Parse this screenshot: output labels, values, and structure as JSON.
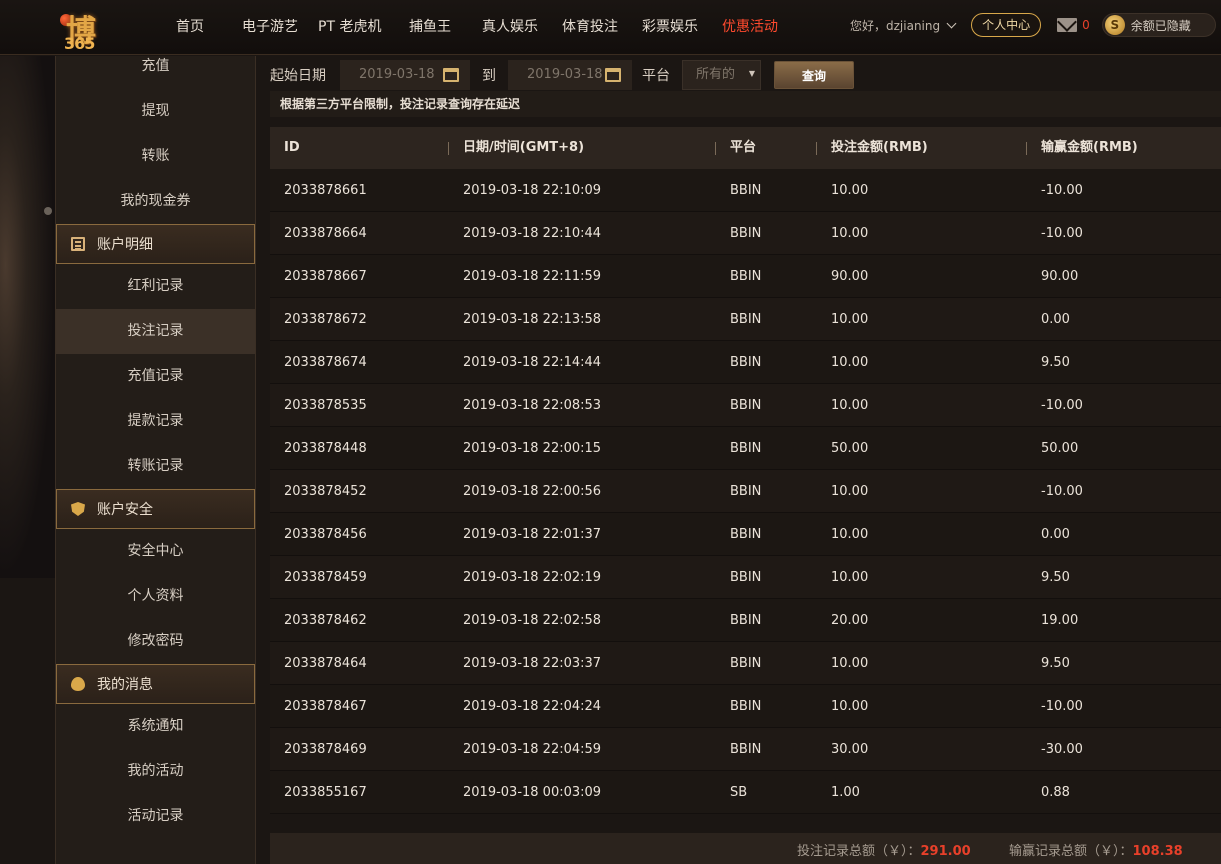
{
  "logo": {
    "text": "博",
    "num": "365"
  },
  "nav": {
    "items": [
      {
        "label": "首页",
        "left": 0
      },
      {
        "label": "电子游艺",
        "left": 0
      },
      {
        "label": "PT 老虎机",
        "left": 0
      },
      {
        "label": "捕鱼王",
        "left": 0
      },
      {
        "label": "真人娱乐",
        "left": 0
      },
      {
        "label": "体育投注",
        "left": 0
      },
      {
        "label": "彩票娱乐",
        "left": 0
      },
      {
        "label": "优惠活动",
        "left": 0
      }
    ]
  },
  "user": {
    "greeting": "您好，dzjianing",
    "center_label": "个人中心",
    "mail_count": "0",
    "balance_label": "余额已隐藏",
    "coin_symbol": "S"
  },
  "sidebar": {
    "top_links": [
      "充值",
      "提现",
      "转账",
      "我的现金券"
    ],
    "account_detail": {
      "title": "账户明细",
      "links": [
        "红利记录",
        "投注记录",
        "充值记录",
        "提款记录",
        "转账记录"
      ],
      "active": "投注记录"
    },
    "account_security": {
      "title": "账户安全",
      "links": [
        "安全中心",
        "个人资料",
        "修改密码"
      ]
    },
    "messages": {
      "title": "我的消息",
      "links": [
        "系统通知",
        "我的活动",
        "活动记录"
      ]
    }
  },
  "filter": {
    "start_label": "起始日期",
    "start_date": "2019-03-18",
    "to_label": "到",
    "end_date": "2019-03-18",
    "platform_label": "平台",
    "platform_value": "所有的",
    "query_label": "查询"
  },
  "notice": "根据第三方平台限制，投注记录查询存在延迟",
  "table": {
    "headers": [
      "ID",
      "日期/时间(GMT+8)",
      "平台",
      "投注金额(RMB)",
      "输赢金额(RMB)"
    ],
    "rows": [
      [
        "2033878661",
        "2019-03-18 22:10:09",
        "BBIN",
        "10.00",
        "-10.00"
      ],
      [
        "2033878664",
        "2019-03-18 22:10:44",
        "BBIN",
        "10.00",
        "-10.00"
      ],
      [
        "2033878667",
        "2019-03-18 22:11:59",
        "BBIN",
        "90.00",
        "90.00"
      ],
      [
        "2033878672",
        "2019-03-18 22:13:58",
        "BBIN",
        "10.00",
        "0.00"
      ],
      [
        "2033878674",
        "2019-03-18 22:14:44",
        "BBIN",
        "10.00",
        "9.50"
      ],
      [
        "2033878535",
        "2019-03-18 22:08:53",
        "BBIN",
        "10.00",
        "-10.00"
      ],
      [
        "2033878448",
        "2019-03-18 22:00:15",
        "BBIN",
        "50.00",
        "50.00"
      ],
      [
        "2033878452",
        "2019-03-18 22:00:56",
        "BBIN",
        "10.00",
        "-10.00"
      ],
      [
        "2033878456",
        "2019-03-18 22:01:37",
        "BBIN",
        "10.00",
        "0.00"
      ],
      [
        "2033878459",
        "2019-03-18 22:02:19",
        "BBIN",
        "10.00",
        "9.50"
      ],
      [
        "2033878462",
        "2019-03-18 22:02:58",
        "BBIN",
        "20.00",
        "19.00"
      ],
      [
        "2033878464",
        "2019-03-18 22:03:37",
        "BBIN",
        "10.00",
        "9.50"
      ],
      [
        "2033878467",
        "2019-03-18 22:04:24",
        "BBIN",
        "10.00",
        "-10.00"
      ],
      [
        "2033878469",
        "2019-03-18 22:04:59",
        "BBIN",
        "30.00",
        "-30.00"
      ],
      [
        "2033855167",
        "2019-03-18 00:03:09",
        "SB",
        "1.00",
        "0.88"
      ]
    ]
  },
  "summary": {
    "bet_label": "投注记录总额（￥）：",
    "bet_total": "291.00",
    "win_label": "输赢记录总额（￥）：",
    "win_total": "108.38"
  },
  "colors": {
    "accent": "#d9a84a",
    "alert": "#e8402a",
    "active_nav": "#ff4a2e"
  }
}
